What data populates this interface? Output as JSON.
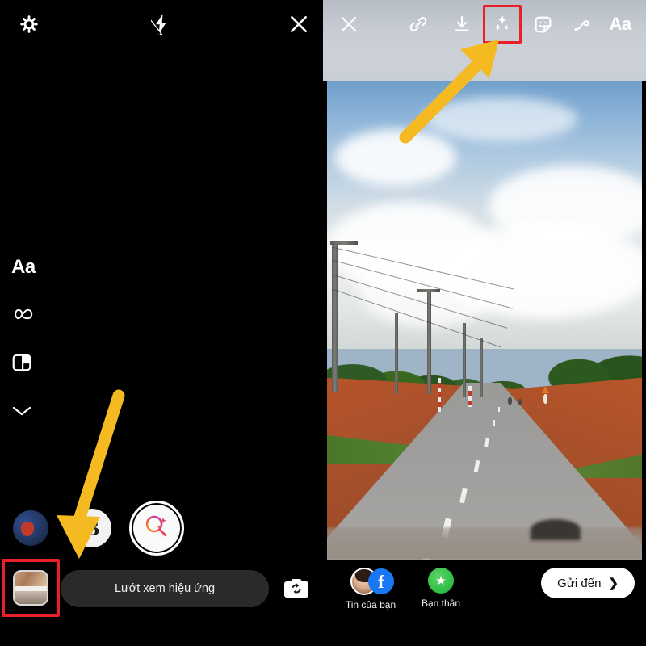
{
  "app": {
    "title": "Facebook Stories camera and story editor",
    "accent_highlight": "#e8202a",
    "arrow_color": "#f5b921"
  },
  "camera_panel": {
    "background": "#000000",
    "top_bar": [
      {
        "name": "settings",
        "icon": "gear-icon",
        "label": "Cài đặt"
      },
      {
        "name": "flash",
        "icon": "flash-off-icon",
        "label": "Đèn flash tắt"
      },
      {
        "name": "close",
        "icon": "close-icon",
        "label": "Đóng"
      }
    ],
    "side_tools": [
      {
        "name": "text",
        "icon": "text-aa-icon",
        "label": "Aa"
      },
      {
        "name": "boomerang",
        "icon": "infinity-icon",
        "label": "Boomerang"
      },
      {
        "name": "layout",
        "icon": "layout-icon",
        "label": "Bố cục"
      },
      {
        "name": "more",
        "icon": "chevron-down-icon",
        "label": "Thêm"
      }
    ],
    "effects": [
      {
        "name": "effect-thumb",
        "icon": "effect-avatar-icon",
        "label": "Hiệu ứng"
      },
      {
        "name": "effect-b",
        "icon": "letter-b-icon",
        "label": "B"
      },
      {
        "name": "effect-browse",
        "icon": "effect-search-icon",
        "label": "Tìm hiệu ứng"
      }
    ],
    "bottom_bar": {
      "gallery_label": "Thư viện ảnh",
      "effect_button_label": "Lướt xem hiệu ứng",
      "flip_camera_label": "Đổi máy ảnh",
      "flip_icon": "camera-flip-icon"
    }
  },
  "story_editor": {
    "top_bar": [
      {
        "name": "close",
        "icon": "close-icon",
        "label": "Đóng"
      },
      {
        "name": "link",
        "icon": "link-icon",
        "label": "Liên kết"
      },
      {
        "name": "save",
        "icon": "download-icon",
        "label": "Lưu"
      },
      {
        "name": "effects",
        "icon": "sparkles-icon",
        "label": "Hiệu ứng",
        "highlighted": true
      },
      {
        "name": "sticker",
        "icon": "sticker-icon",
        "label": "Nhãn dán"
      },
      {
        "name": "draw",
        "icon": "draw-icon",
        "label": "Vẽ"
      },
      {
        "name": "text",
        "icon": "text-aa-icon",
        "label": "Aa"
      }
    ],
    "photo": {
      "alt": "Ảnh con đường nhựa thẳng với cột điện, đất đỏ và cây xanh hai bên",
      "sky_color": "#c5d6e4",
      "road_color": "#9d9c9a",
      "soil_color": "#a8512c",
      "grass_color": "#4d8c32"
    },
    "footer": {
      "destinations": [
        {
          "name": "your-story",
          "label": "Tin của bạn",
          "badge": "facebook",
          "badge_glyph": "f"
        },
        {
          "name": "close-friends",
          "label": "Bạn thân",
          "badge": "star",
          "badge_glyph": "★"
        }
      ],
      "send_button": {
        "label": "Gửi đến",
        "chevron": "❯"
      }
    }
  }
}
